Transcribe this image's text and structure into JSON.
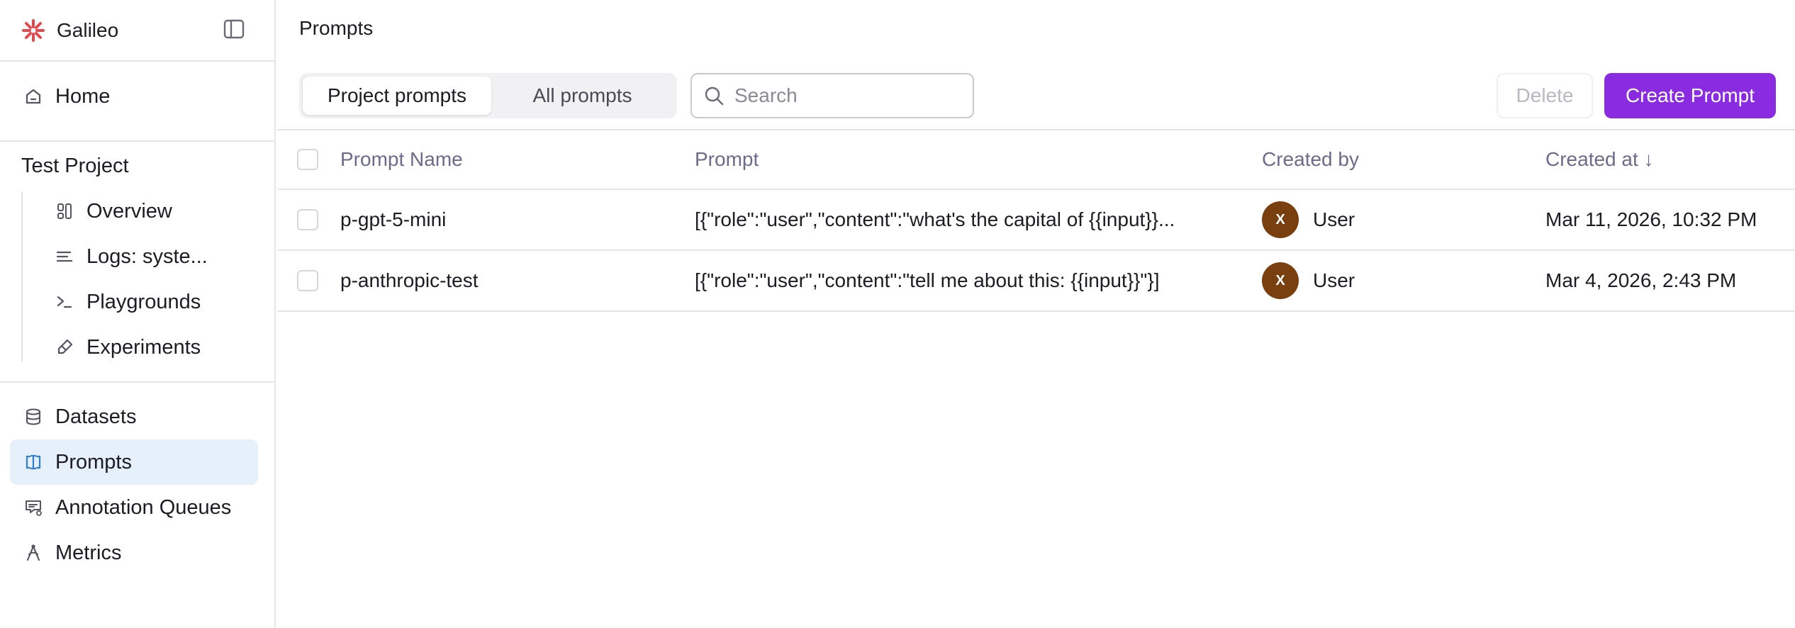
{
  "brand": {
    "name": "Galileo"
  },
  "sidebar": {
    "home": "Home",
    "project_title": "Test Project",
    "project_items": [
      {
        "label": "Overview",
        "icon": "overview-icon"
      },
      {
        "label": "Logs: syste...",
        "icon": "logs-icon"
      },
      {
        "label": "Playgrounds",
        "icon": "terminal-icon"
      },
      {
        "label": "Experiments",
        "icon": "flask-icon"
      }
    ],
    "items": [
      {
        "label": "Datasets",
        "icon": "database-icon"
      },
      {
        "label": "Prompts",
        "icon": "prompt-icon",
        "active": true
      },
      {
        "label": "Annotation Queues",
        "icon": "annotation-icon"
      },
      {
        "label": "Metrics",
        "icon": "metrics-icon"
      }
    ]
  },
  "page": {
    "title": "Prompts"
  },
  "tabs": [
    {
      "label": "Project prompts",
      "active": true
    },
    {
      "label": "All prompts",
      "active": false
    }
  ],
  "search": {
    "placeholder": "Search",
    "value": ""
  },
  "actions": {
    "delete": "Delete",
    "create": "Create Prompt"
  },
  "table": {
    "columns": [
      "Prompt Name",
      "Prompt",
      "Created by",
      "Created at ↓"
    ],
    "rows": [
      {
        "name": "p-gpt-5-mini",
        "prompt": "[{\"role\":\"user\",\"content\":\"what's the capital of {{input}}...",
        "avatar": "X",
        "created_by": "User",
        "created_at": "Mar 11, 2026, 10:32 PM"
      },
      {
        "name": "p-anthropic-test",
        "prompt": "[{\"role\":\"user\",\"content\":\"tell me about this: {{input}}\"}]",
        "avatar": "X",
        "created_by": "User",
        "created_at": "Mar 4, 2026, 2:43 PM"
      }
    ]
  },
  "colors": {
    "accent": "#8a2be2",
    "active_nav_bg": "#e6f0fb",
    "avatar_bg": "#7a3f0f",
    "logo": "#e5484d"
  }
}
